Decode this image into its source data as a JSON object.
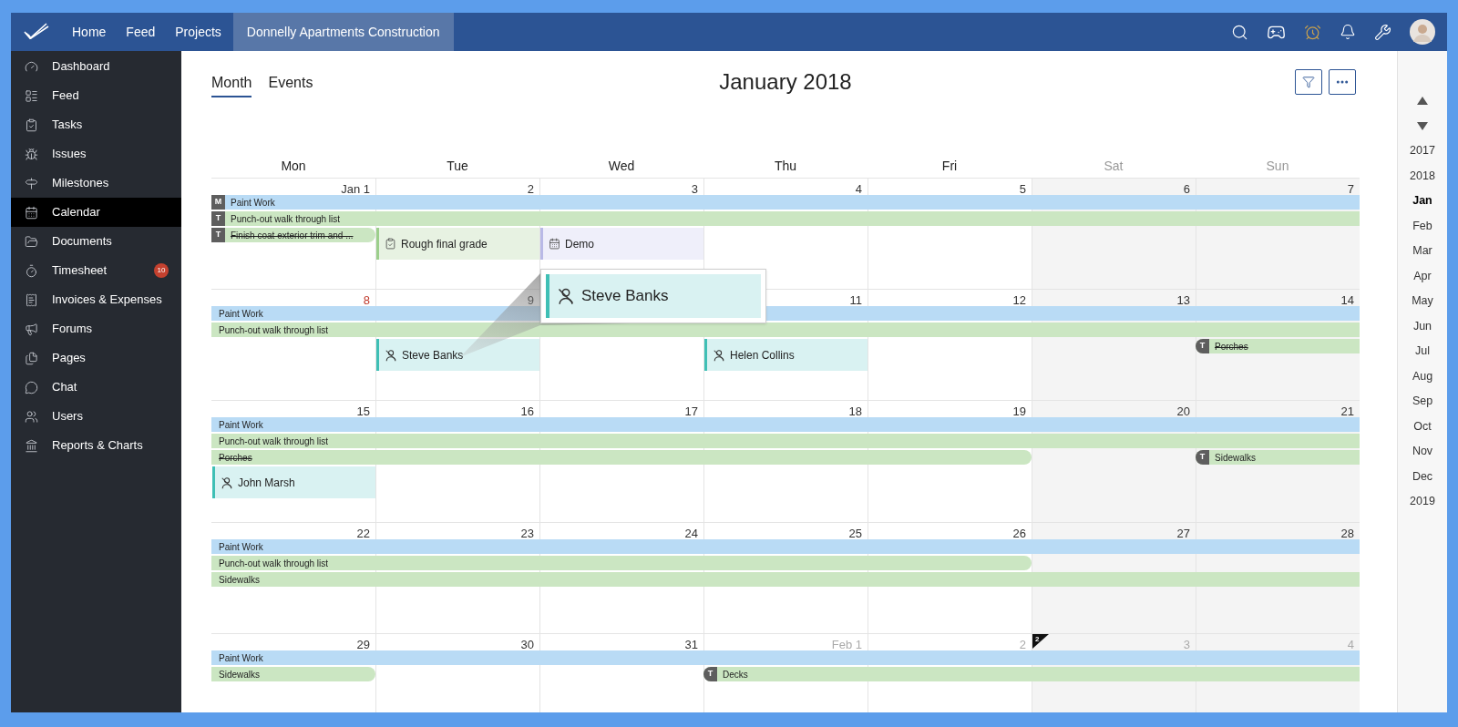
{
  "topbar": {
    "items": [
      {
        "label": "Home",
        "selected": false
      },
      {
        "label": "Feed",
        "selected": false
      },
      {
        "label": "Projects",
        "selected": false
      },
      {
        "label": "Donnelly Apartments Construction",
        "selected": true
      }
    ]
  },
  "sidebar": {
    "items": [
      {
        "label": "Dashboard",
        "selected": false
      },
      {
        "label": "Feed",
        "selected": false
      },
      {
        "label": "Tasks",
        "selected": false
      },
      {
        "label": "Issues",
        "selected": false
      },
      {
        "label": "Milestones",
        "selected": false
      },
      {
        "label": "Calendar",
        "selected": true
      },
      {
        "label": "Documents",
        "selected": false
      },
      {
        "label": "Timesheet",
        "selected": false,
        "badge": "10"
      },
      {
        "label": "Invoices & Expenses",
        "selected": false
      },
      {
        "label": "Forums",
        "selected": false
      },
      {
        "label": "Pages",
        "selected": false
      },
      {
        "label": "Chat",
        "selected": false
      },
      {
        "label": "Users",
        "selected": false
      },
      {
        "label": "Reports & Charts",
        "selected": false
      }
    ]
  },
  "view_tabs": [
    {
      "label": "Month",
      "selected": true
    },
    {
      "label": "Events",
      "selected": false
    }
  ],
  "title": "January 2018",
  "weekdays": [
    {
      "label": "Mon",
      "weekend": false
    },
    {
      "label": "Tue",
      "weekend": false
    },
    {
      "label": "Wed",
      "weekend": false
    },
    {
      "label": "Thu",
      "weekend": false
    },
    {
      "label": "Fri",
      "weekend": false
    },
    {
      "label": "Sat",
      "weekend": true
    },
    {
      "label": "Sun",
      "weekend": true
    }
  ],
  "weeks": [
    {
      "days": [
        {
          "label": "Jan 1",
          "kind": "normal"
        },
        {
          "label": "2",
          "kind": "normal"
        },
        {
          "label": "3",
          "kind": "normal"
        },
        {
          "label": "4",
          "kind": "normal"
        },
        {
          "label": "5",
          "kind": "normal"
        },
        {
          "label": "6",
          "kind": "normal"
        },
        {
          "label": "7",
          "kind": "normal"
        }
      ],
      "lanes": [
        [
          {
            "kind": "bar",
            "title": "Paint Work",
            "badge": "M",
            "color": "#b9dbf5",
            "done": false
          },
          {
            "kind": "continued"
          },
          {
            "kind": "continued"
          },
          {
            "kind": "continued"
          },
          {
            "kind": "continued"
          },
          {
            "kind": "continued"
          },
          {
            "kind": "continued"
          }
        ],
        [
          {
            "kind": "bar",
            "title": "Punch-out walk through list",
            "badge": "T",
            "color": "#cbe6c2",
            "done": false
          },
          {
            "kind": "continued"
          },
          {
            "kind": "continued"
          },
          {
            "kind": "continued"
          },
          {
            "kind": "continued"
          },
          {
            "kind": "continued"
          },
          {
            "kind": "continued"
          }
        ],
        [
          {
            "kind": "bar",
            "title": "Finish coat exterior trim and ...",
            "badge": "T",
            "color": "#cbe6c2",
            "done": true
          },
          {
            "kind": "task",
            "title": "Rough final grade",
            "color": "#e7f2e2"
          },
          {
            "kind": "event",
            "title": "Demo",
            "color": "#efeffa"
          },
          {
            "kind": "empty"
          },
          {
            "kind": "empty"
          },
          {
            "kind": "empty"
          },
          {
            "kind": "empty"
          }
        ]
      ]
    },
    {
      "days": [
        {
          "label": "8",
          "kind": "holiday"
        },
        {
          "label": "9",
          "kind": "normal"
        },
        {
          "kind": "normal"
        },
        {
          "label": "11",
          "kind": "normal"
        },
        {
          "label": "12",
          "kind": "normal"
        },
        {
          "label": "13",
          "kind": "normal"
        },
        {
          "label": "14",
          "kind": "normal"
        }
      ],
      "lanes": [
        [
          {
            "kind": "bar",
            "title": "Paint Work",
            "color": "#b9dbf5",
            "done": false
          },
          {
            "kind": "continued"
          },
          {
            "kind": "continued"
          },
          {
            "kind": "continued"
          },
          {
            "kind": "continued"
          },
          {
            "kind": "continued"
          },
          {
            "kind": "continued"
          }
        ],
        [
          {
            "kind": "bar",
            "title": "Punch-out walk through list",
            "color": "#cbe6c2",
            "done": false
          },
          {
            "kind": "continued"
          },
          {
            "kind": "continued"
          },
          {
            "kind": "continued"
          },
          {
            "kind": "continued"
          },
          {
            "kind": "continued"
          },
          {
            "kind": "continued"
          }
        ],
        [
          {
            "kind": "empty"
          },
          {
            "kind": "person",
            "title": "Steve Banks",
            "color": "#d9f2f2"
          },
          {
            "kind": "empty"
          },
          {
            "kind": "person",
            "title": "Helen Collins",
            "color": "#d9f2f2"
          },
          {
            "kind": "empty"
          },
          {
            "kind": "empty"
          },
          {
            "kind": "bar",
            "title": "Porches",
            "badge": "T",
            "color": "#cbe6c2",
            "done": true
          }
        ]
      ]
    },
    {
      "days": [
        {
          "label": "15",
          "kind": "normal"
        },
        {
          "label": "16",
          "kind": "normal"
        },
        {
          "label": "17",
          "kind": "normal"
        },
        {
          "label": "18",
          "kind": "normal"
        },
        {
          "label": "19",
          "kind": "normal"
        },
        {
          "label": "20",
          "kind": "normal"
        },
        {
          "label": "21",
          "kind": "normal"
        }
      ],
      "lanes": [
        [
          {
            "kind": "bar",
            "title": "Paint Work",
            "color": "#b9dbf5",
            "done": false
          },
          {
            "kind": "continued"
          },
          {
            "kind": "continued"
          },
          {
            "kind": "continued"
          },
          {
            "kind": "continued"
          },
          {
            "kind": "continued"
          },
          {
            "kind": "continued"
          }
        ],
        [
          {
            "kind": "bar",
            "title": "Punch-out walk through list",
            "color": "#cbe6c2",
            "done": false
          },
          {
            "kind": "continued"
          },
          {
            "kind": "continued"
          },
          {
            "kind": "continued"
          },
          {
            "kind": "continued"
          },
          {
            "kind": "continued"
          },
          {
            "kind": "continued"
          }
        ],
        [
          {
            "kind": "bar",
            "title": "Porches",
            "color": "#cbe6c2",
            "done": true
          },
          {
            "kind": "continued"
          },
          {
            "kind": "continued"
          },
          {
            "kind": "continued"
          },
          {
            "kind": "continued"
          },
          {
            "kind": "empty"
          },
          {
            "kind": "bar",
            "title": "Sidewalks",
            "badge": "T",
            "color": "#cbe6c2",
            "done": false
          }
        ],
        [
          {
            "kind": "person",
            "title": "John Marsh",
            "color": "#d9f2f2"
          },
          {
            "kind": "empty"
          },
          {
            "kind": "empty"
          },
          {
            "kind": "empty"
          },
          {
            "kind": "empty"
          },
          {
            "kind": "empty"
          },
          {
            "kind": "empty"
          }
        ]
      ]
    },
    {
      "days": [
        {
          "label": "22",
          "kind": "normal"
        },
        {
          "label": "23",
          "kind": "normal"
        },
        {
          "label": "24",
          "kind": "normal"
        },
        {
          "label": "25",
          "kind": "normal"
        },
        {
          "label": "26",
          "kind": "normal"
        },
        {
          "label": "27",
          "kind": "normal"
        },
        {
          "label": "28",
          "kind": "normal"
        }
      ],
      "lanes": [
        [
          {
            "kind": "bar",
            "title": "Paint Work",
            "color": "#b9dbf5",
            "done": false
          },
          {
            "kind": "continued"
          },
          {
            "kind": "continued"
          },
          {
            "kind": "continued"
          },
          {
            "kind": "continued"
          },
          {
            "kind": "continued"
          },
          {
            "kind": "continued"
          }
        ],
        [
          {
            "kind": "bar",
            "title": "Punch-out walk through list",
            "color": "#cbe6c2",
            "done": false
          },
          {
            "kind": "continued"
          },
          {
            "kind": "continued"
          },
          {
            "kind": "continued"
          },
          {
            "kind": "continued"
          },
          {
            "kind": "empty"
          },
          {
            "kind": "empty"
          }
        ],
        [
          {
            "kind": "bar",
            "title": "Sidewalks",
            "color": "#cbe6c2",
            "done": false
          },
          {
            "kind": "continued"
          },
          {
            "kind": "continued"
          },
          {
            "kind": "continued"
          },
          {
            "kind": "continued"
          },
          {
            "kind": "continued"
          },
          {
            "kind": "continued"
          }
        ]
      ]
    },
    {
      "days": [
        {
          "label": "29",
          "kind": "normal"
        },
        {
          "label": "30",
          "kind": "normal"
        },
        {
          "label": "31",
          "kind": "normal"
        },
        {
          "label": "Feb 1",
          "kind": "other_month"
        },
        {
          "label": "2",
          "kind": "other_month"
        },
        {
          "label": "3",
          "kind": "other_month",
          "flag": "2"
        },
        {
          "label": "4",
          "kind": "other_month"
        }
      ],
      "lanes": [
        [
          {
            "kind": "bar",
            "title": "Paint Work",
            "color": "#b9dbf5",
            "done": false
          },
          {
            "kind": "continued"
          },
          {
            "kind": "continued"
          },
          {
            "kind": "continued"
          },
          {
            "kind": "continued"
          },
          {
            "kind": "continued"
          },
          {
            "kind": "continued"
          }
        ],
        [
          {
            "kind": "bar",
            "title": "Sidewalks",
            "color": "#cbe6c2",
            "done": false
          },
          {
            "kind": "empty"
          },
          {
            "kind": "empty"
          },
          {
            "kind": "bar",
            "title": "Decks",
            "badge": "T",
            "color": "#cbe6c2",
            "done": false
          },
          {
            "kind": "continued"
          },
          {
            "kind": "continued"
          },
          {
            "kind": "continued"
          }
        ]
      ]
    }
  ],
  "callout": {
    "kind": "person",
    "title": "Steve Banks"
  },
  "timeline": [
    {
      "label": "2017",
      "selected": false
    },
    {
      "label": "2018",
      "selected": false
    },
    {
      "label": "Jan",
      "selected": true
    },
    {
      "label": "Feb",
      "selected": false
    },
    {
      "label": "Mar",
      "selected": false
    },
    {
      "label": "Apr",
      "selected": false
    },
    {
      "label": "May",
      "selected": false
    },
    {
      "label": "Jun",
      "selected": false
    },
    {
      "label": "Jul",
      "selected": false
    },
    {
      "label": "Aug",
      "selected": false
    },
    {
      "label": "Sep",
      "selected": false
    },
    {
      "label": "Oct",
      "selected": false
    },
    {
      "label": "Nov",
      "selected": false
    },
    {
      "label": "Dec",
      "selected": false
    },
    {
      "label": "2019",
      "selected": false
    }
  ]
}
